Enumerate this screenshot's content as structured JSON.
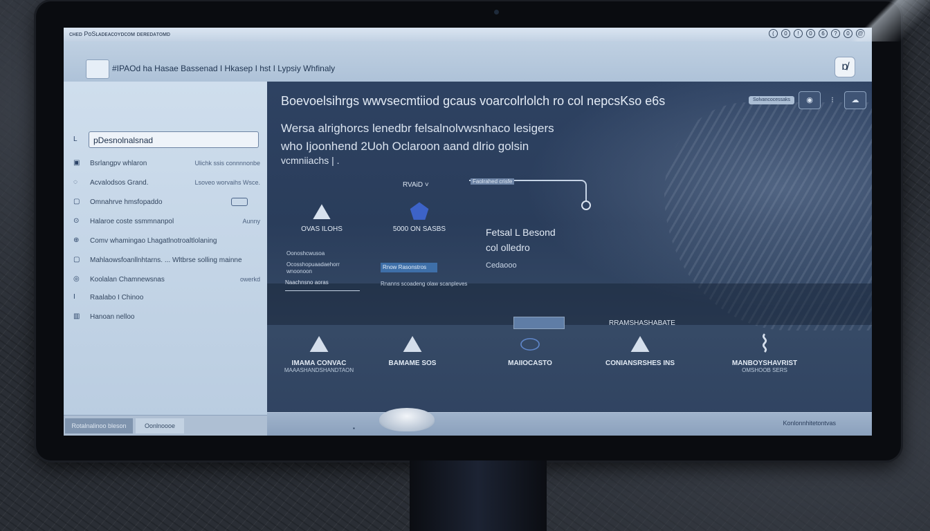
{
  "window": {
    "title": "ᴄʜᴇᴅ PoSʟᴀᴅᴇᴀᴄᴏʏᴅᴄᴏᴍ ᴅᴇʀᴇᴅᴀᴛᴏᴍᴅ",
    "controls": [
      "(",
      "0",
      "!",
      "0",
      "6",
      "?",
      "0",
      "@"
    ]
  },
  "header": {
    "app_name": "#IPAOd ha  Hasae Bassenad  I Hkasep I hst I Lypsiy Whfinaly",
    "close_icon": "ɒ̸"
  },
  "sidebar": {
    "search_value": "pDesnolnalsnad",
    "items": [
      {
        "icon": "▣",
        "label": "Bsrlangpv whlaron",
        "meta": "Ulichk ssis connnnonbe"
      },
      {
        "icon": "◌",
        "label": "Acvalodsos Grand.",
        "meta": "Lsoveo worvaihs Wsce."
      },
      {
        "icon": "▢",
        "label": "Omnahrve hmsfopaddo",
        "meta": ""
      },
      {
        "icon": "⊙",
        "label": "Halaroe coste ssmmnanpol",
        "meta": "Aunny"
      },
      {
        "icon": "⊕",
        "label": "Comv whamingao Lhagatlnotroaltlolaning",
        "meta": ""
      },
      {
        "icon": "▢",
        "label": "Mahlaowsfoanllnhtarns. ... Wltbrse solling mainne",
        "meta": ""
      },
      {
        "icon": "◎",
        "label": "Koolalan   Chamnewsnas",
        "meta": "owerkd"
      },
      {
        "icon": "I",
        "label": "Raalabo I Chinoo",
        "meta": ""
      },
      {
        "icon": "▥",
        "label": "Hanoan nelloo",
        "meta": ""
      }
    ],
    "footer": {
      "btn1": "Rotalnalinoo bleson",
      "btn2": "Oonlnoooe"
    }
  },
  "main": {
    "headline": "Boevoelsihrgs wwvsecmtiiod gcaus voarcolrlolch ro col nepcsKso e6s",
    "sub1": "Wersa alrighorcs lenedbr felsalnolvwsnhaco lesigers",
    "sub2": "who Ijoonhend 2Uoh Oclaroon aand dlrio golsin",
    "sub3": "vcmniiachs | .",
    "tag": "RVAiD ˅",
    "pill": "Solvancocessaks",
    "features": [
      {
        "icon": "⛰",
        "caption": "OVAS  ILOHS"
      },
      {
        "icon": "⬟",
        "caption": "5000 ON SASBS"
      }
    ],
    "card_label": "Faolrahed crisfe",
    "card_title": "Fetsal L Besond",
    "card_sub": "col olledro",
    "card_note": "Cedaooo",
    "links": [
      "Oonoshcwusoa",
      "Ocosshopuaadaehorr",
      "wnoonoon"
    ],
    "mini_btn": "Naachnsno aoras",
    "hl_text": "Rnow Rasonstros",
    "hl_sub": "Rnanns scoadeng olaw scanpleves",
    "mid_label": "RRAMSHASHABATE",
    "bottom": [
      {
        "icon": "⛰",
        "caption": "IMAMA  CONVAC",
        "caption2": "MAAASHANDSHANDTAON"
      },
      {
        "icon": "⛰",
        "caption": "BAMAME SOS",
        "caption2": ""
      },
      {
        "icon": "⬭",
        "caption": "MAIIOCASTO",
        "caption2": ""
      },
      {
        "icon": "⛰",
        "caption": "CONIANSRSHES INS",
        "caption2": ""
      },
      {
        "icon": "⌇",
        "caption": "MANBOYSHAVRIST",
        "caption2": "OMSHOOB SERS"
      }
    ],
    "status_text": "Konlonnhitetontvas",
    "status_mark": "▪"
  }
}
